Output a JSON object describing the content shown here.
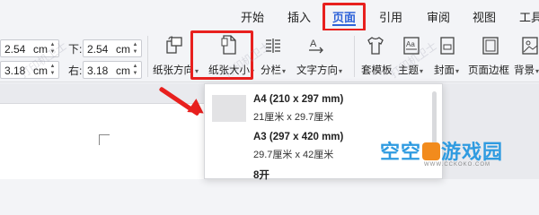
{
  "tabs": [
    {
      "label": "开始"
    },
    {
      "label": "插入"
    },
    {
      "label": "页面"
    },
    {
      "label": "引用"
    },
    {
      "label": "审阅"
    },
    {
      "label": "视图"
    },
    {
      "label": "工具"
    }
  ],
  "margins": {
    "top_left_value": "2.54",
    "top_left_unit": "cm",
    "bottom_left_value": "3.18",
    "bottom_left_unit": "cm",
    "top_right_label": "下:",
    "top_right_value": "2.54",
    "top_right_unit": "cm",
    "bottom_right_label": "右:",
    "bottom_right_value": "3.18",
    "bottom_right_unit": "cm"
  },
  "toolbar": {
    "orientation_label": "纸张方向",
    "size_label": "纸张大小",
    "columns_label": "分栏",
    "text_direction_label": "文字方向",
    "template_label": "套模板",
    "theme_label": "主题",
    "cover_label": "封面",
    "border_label": "页面边框",
    "background_label": "背景"
  },
  "paper_sizes": [
    {
      "name": "A4 (210 x 297 mm)",
      "dims": "21厘米  x  29.7厘米"
    },
    {
      "name": "A3 (297 x 420 mm)",
      "dims": "29.7厘米  x  42厘米"
    },
    {
      "name": "8开",
      "dims": ""
    }
  ],
  "watermark": {
    "text": "打印机卫士",
    "logo_part1": "空空",
    "logo_part2": "游戏园",
    "logo_url": "WWW.CCKOKO.COM"
  },
  "colors": {
    "accent": "#2f63d8",
    "highlight": "#e8201e"
  }
}
